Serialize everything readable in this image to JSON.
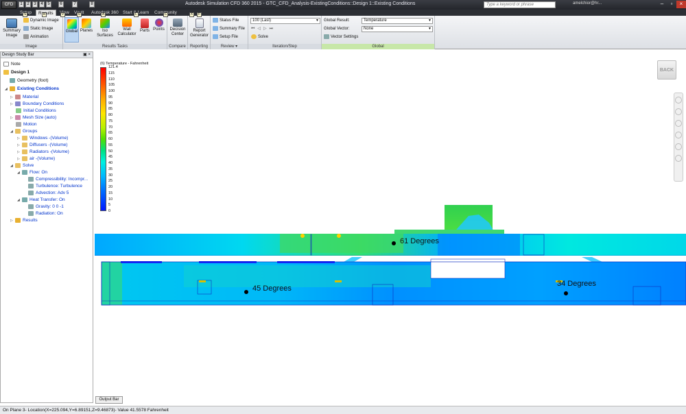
{
  "titlebar": {
    "app_button": "CFD 360",
    "title": "Autodesk Simulation CFD 360 2015 - GTC_CFD_Analysis-ExistingConditions::Design 1::Existing Conditions",
    "search_placeholder": "Type a keyword or phrase",
    "user": "amelchior@hr..."
  },
  "quick_access": [
    "1",
    "2",
    "3",
    "4",
    "5",
    "6",
    "7",
    "8"
  ],
  "tabs": [
    "Setup",
    "Results",
    "View",
    "Vault",
    "Autodesk 360",
    "Start & Learn",
    "Community"
  ],
  "keytips": [
    "S",
    "R",
    "V",
    "U",
    "A",
    "L",
    "C",
    "X",
    "F"
  ],
  "ribbon": {
    "image": {
      "label": "Image",
      "summary_image": "Summary Image",
      "dynamic_image": "Dynamic Image",
      "static_image": "Static Image",
      "animation": "Animation"
    },
    "results_tasks": {
      "label": "Results Tasks",
      "global": "Global",
      "planes": "Planes",
      "iso_surfaces": "Iso Surfaces",
      "wall_calculator": "Wall Calculator",
      "parts": "Parts",
      "points": "Points"
    },
    "compare": {
      "label": "Compare",
      "decision_center": "Decision Center"
    },
    "reporting": {
      "label": "Reporting",
      "report_generator": "Report Generator"
    },
    "review": {
      "label": "Review",
      "status_file": "Status File",
      "summary_file": "Summary File",
      "setup_file": "Setup File"
    },
    "iteration": {
      "label": "Iteration/Step",
      "value": "100 (Last)",
      "solve": "Solve"
    },
    "global": {
      "label": "Global",
      "result_label": "Global Result:",
      "result_value": "Temperature",
      "vector_label": "Global Vector:",
      "vector_value": "None",
      "vector_settings": "Vector Settings"
    }
  },
  "studybar": {
    "header": "Design Study Bar",
    "items": [
      {
        "label": "Note"
      },
      {
        "label": "Design 1"
      },
      {
        "label": "Geometry (foot)"
      },
      {
        "label": "Existing Conditions"
      },
      {
        "label": "Material"
      },
      {
        "label": "Boundary Conditions"
      },
      {
        "label": "Initial Conditions"
      },
      {
        "label": "Mesh Size (auto)"
      },
      {
        "label": "Motion"
      },
      {
        "label": "Groups"
      },
      {
        "label": "Windows -(Volume)"
      },
      {
        "label": "Diffusers -(Volume)"
      },
      {
        "label": "Radiators -(Volume)"
      },
      {
        "label": "air -(Volume)"
      },
      {
        "label": "Solve"
      },
      {
        "label": "Flow: On"
      },
      {
        "label": "Compressibility: Incompr..."
      },
      {
        "label": "Turbulence: Turbulence"
      },
      {
        "label": "Advection: Adv 5"
      },
      {
        "label": "Heat Transfer: On"
      },
      {
        "label": "Gravity: 0 0 -1"
      },
      {
        "label": "Radiation: On"
      },
      {
        "label": "Results"
      }
    ]
  },
  "viewport": {
    "back_button": "BACK",
    "legend_title": "(6) Temperature - Fahrenheit",
    "legend_ticks": [
      "121.4",
      "115",
      "110",
      "105",
      "100",
      "95",
      "90",
      "85",
      "80",
      "75",
      "70",
      "65",
      "60",
      "55",
      "50",
      "45",
      "40",
      "35",
      "30",
      "25",
      "20",
      "15",
      "10",
      "5",
      "0"
    ],
    "annotations": [
      "61 Degrees",
      "45 Degrees",
      "34 Degrees"
    ]
  },
  "output_bar": "Output Bar",
  "status": "On Plane 3-  Location(X=225.094,Y=6.89151,Z=9.46873)- Value  41.5578  Fahrenheit"
}
